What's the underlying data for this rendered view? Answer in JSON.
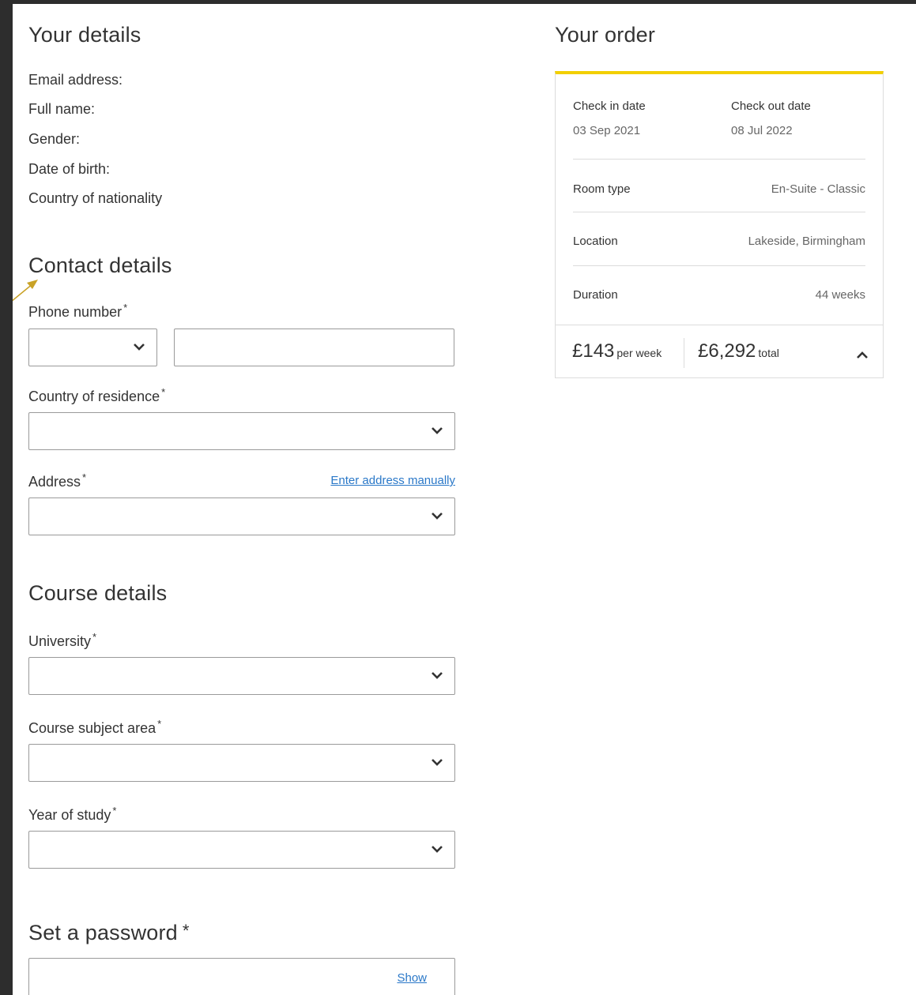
{
  "details": {
    "title": "Your details",
    "fields": [
      "Email address:",
      "Full name:",
      "Gender:",
      "Date of birth:",
      "Country of nationality"
    ]
  },
  "contact": {
    "title": "Contact details",
    "phone_label": "Phone number",
    "residence_label": "Country of residence",
    "address_label": "Address",
    "manual_link": "Enter address manually",
    "required_mark": "*"
  },
  "course": {
    "title": "Course details",
    "university_label": "University",
    "subject_label": "Course subject area",
    "year_label": "Year of study"
  },
  "password": {
    "title": "Set a password",
    "show_link": "Show"
  },
  "order": {
    "title": "Your order",
    "check_in_label": "Check in date",
    "check_in_value": "03 Sep 2021",
    "check_out_label": "Check out date",
    "check_out_value": "08 Jul 2022",
    "room_type_label": "Room type",
    "room_type_value": "En-Suite - Classic",
    "location_label": "Location",
    "location_value": "Lakeside, Birmingham",
    "duration_label": "Duration",
    "duration_value": "44 weeks",
    "weekly_price": "£143",
    "weekly_suffix": "per week",
    "total_price": "£6,292",
    "total_suffix": "total"
  },
  "colors": {
    "accent": "#f2cf00",
    "link": "#2a78c8",
    "annotation": "#c9a227"
  }
}
